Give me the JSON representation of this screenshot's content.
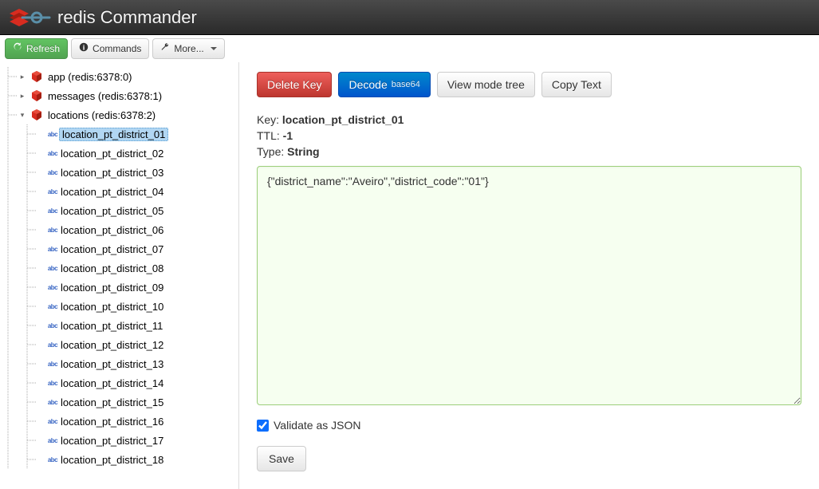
{
  "app": {
    "title": "redis Commander"
  },
  "toolbar": {
    "refresh": "Refresh",
    "commands": "Commands",
    "more": "More..."
  },
  "actions": {
    "delete_key": "Delete Key",
    "decode": "Decode",
    "decode_sub": "base64",
    "view_mode": "View mode tree",
    "copy_text": "Copy Text"
  },
  "meta": {
    "key_label": "Key:",
    "key_value": "location_pt_district_01",
    "ttl_label": "TTL:",
    "ttl_value": "-1",
    "type_label": "Type:",
    "type_value": "String"
  },
  "value_content": "{\"district_name\":\"Aveiro\",\"district_code\":\"01\"}",
  "validate": {
    "label": "Validate as JSON",
    "checked": true
  },
  "save": {
    "label": "Save"
  },
  "tree": {
    "roots": [
      {
        "label": "app (redis:6378:0)",
        "expanded": false
      },
      {
        "label": "messages (redis:6378:1)",
        "expanded": false
      },
      {
        "label": "locations (redis:6378:2)",
        "expanded": true
      }
    ],
    "children": [
      {
        "label": "location_pt_district_01",
        "selected": true
      },
      {
        "label": "location_pt_district_02"
      },
      {
        "label": "location_pt_district_03"
      },
      {
        "label": "location_pt_district_04"
      },
      {
        "label": "location_pt_district_05"
      },
      {
        "label": "location_pt_district_06"
      },
      {
        "label": "location_pt_district_07"
      },
      {
        "label": "location_pt_district_08"
      },
      {
        "label": "location_pt_district_09"
      },
      {
        "label": "location_pt_district_10"
      },
      {
        "label": "location_pt_district_11"
      },
      {
        "label": "location_pt_district_12"
      },
      {
        "label": "location_pt_district_13"
      },
      {
        "label": "location_pt_district_14"
      },
      {
        "label": "location_pt_district_15"
      },
      {
        "label": "location_pt_district_16"
      },
      {
        "label": "location_pt_district_17"
      },
      {
        "label": "location_pt_district_18"
      }
    ]
  }
}
